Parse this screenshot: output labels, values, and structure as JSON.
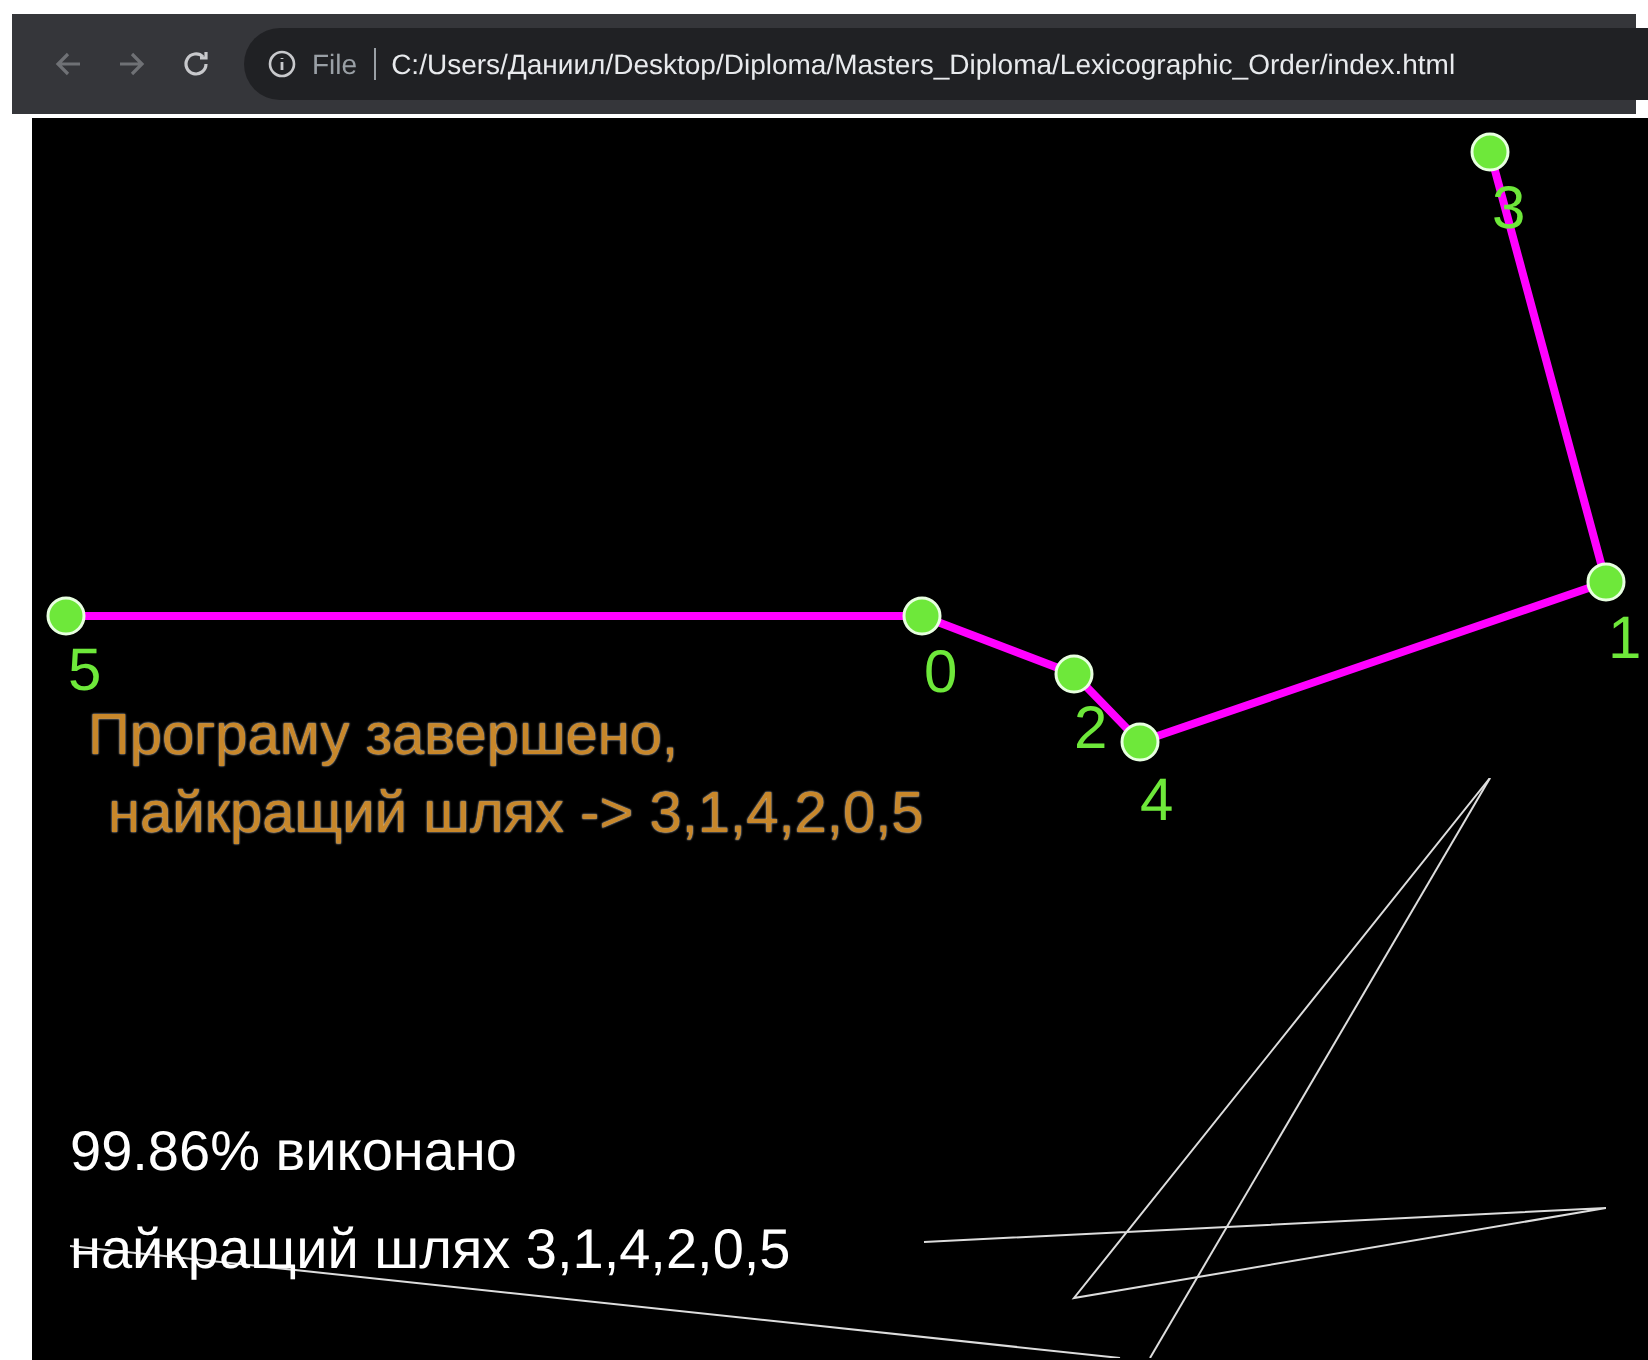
{
  "browser": {
    "scheme": "File",
    "url": "C:/Users/Даниил/Desktop/Diploma/Masters_Diploma/Lexicographic_Order/index.html"
  },
  "canvas": {
    "nodes": [
      {
        "label": "5"
      },
      {
        "label": "0"
      },
      {
        "label": "2"
      },
      {
        "label": "4"
      },
      {
        "label": "1"
      },
      {
        "label": "3"
      }
    ],
    "result": [
      "Програму завершено,",
      "найкращий шлях -> 3,1,4,2,0,5"
    ],
    "progress": "99.86% виконано",
    "best": "найкращий шлях 3,1,4,2,0,5"
  }
}
